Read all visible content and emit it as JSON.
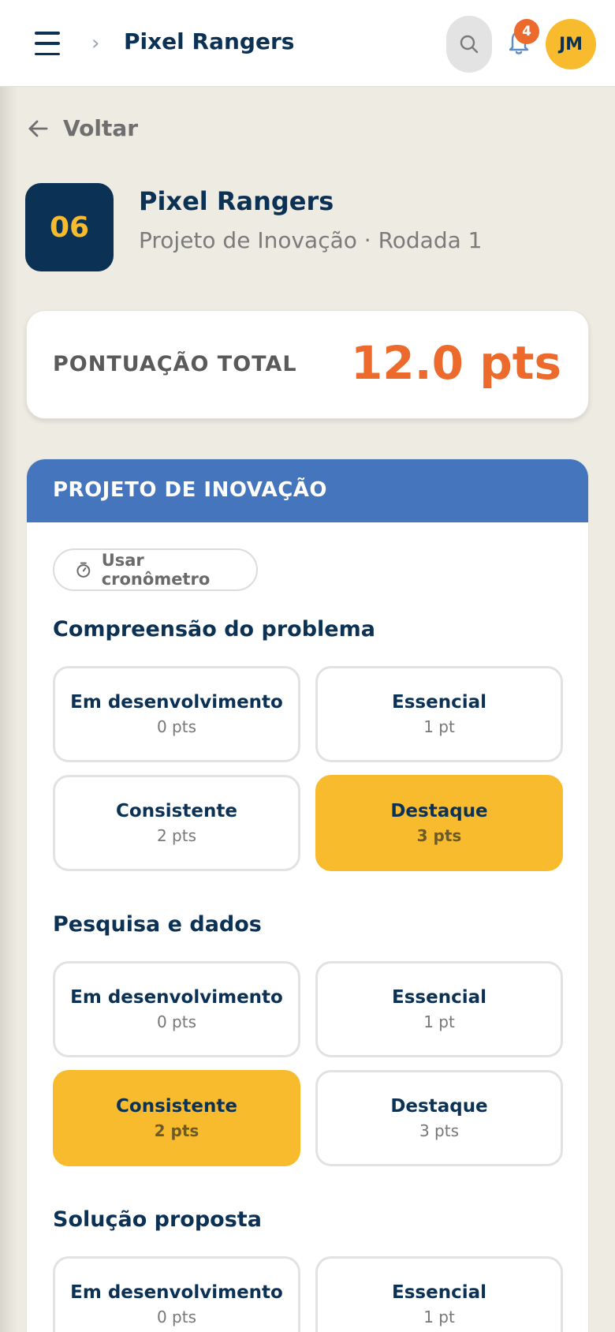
{
  "header": {
    "title": "Pixel Rangers",
    "notifications_count": "4",
    "avatar_initials": "JM"
  },
  "back_label": "Voltar",
  "team": {
    "number": "06",
    "name": "Pixel Rangers",
    "subtitle": "Projeto de Inovação · Rodada 1"
  },
  "score": {
    "label": "PONTUAÇÃO TOTAL",
    "value": "12.0 pts"
  },
  "section": {
    "title": "PROJETO DE INOVAÇÃO",
    "timer_label": "Usar cronômetro",
    "criteria": [
      {
        "title": "Compreensão do problema",
        "options": [
          {
            "label": "Em desenvolvimento",
            "points": "0 pts",
            "selected": false
          },
          {
            "label": "Essencial",
            "points": "1 pt",
            "selected": false
          },
          {
            "label": "Consistente",
            "points": "2 pts",
            "selected": false
          },
          {
            "label": "Destaque",
            "points": "3 pts",
            "selected": true
          }
        ]
      },
      {
        "title": "Pesquisa e dados",
        "options": [
          {
            "label": "Em desenvolvimento",
            "points": "0 pts",
            "selected": false
          },
          {
            "label": "Essencial",
            "points": "1 pt",
            "selected": false
          },
          {
            "label": "Consistente",
            "points": "2 pts",
            "selected": true
          },
          {
            "label": "Destaque",
            "points": "3 pts",
            "selected": false
          }
        ]
      },
      {
        "title": "Solução proposta",
        "options": [
          {
            "label": "Em desenvolvimento",
            "points": "0 pts",
            "selected": false
          },
          {
            "label": "Essencial",
            "points": "1 pt",
            "selected": false
          }
        ]
      }
    ]
  },
  "colors": {
    "brand_navy": "#0b3155",
    "accent_yellow": "#f8bb2d",
    "score_orange": "#ec6a2c",
    "section_blue": "#4575bc"
  }
}
